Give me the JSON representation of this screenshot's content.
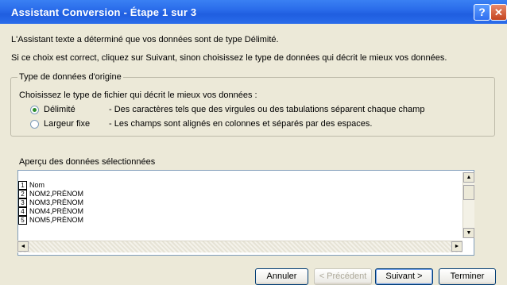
{
  "window": {
    "title": "Assistant Conversion - Étape 1 sur 3",
    "help_label": "?",
    "close_label": "✕"
  },
  "intro": {
    "line1": "L'Assistant texte a déterminé que vos données sont de type Délimité.",
    "line2": "Si ce choix est correct, cliquez sur Suivant, sinon choisissez le type de données qui décrit le mieux vos données."
  },
  "original_type": {
    "legend": "Type de données d'origine",
    "prompt": "Choisissez le type de fichier qui décrit le mieux vos données :",
    "options": [
      {
        "label": "Délimité",
        "description": "- Des caractères tels que des virgules ou des tabulations séparent chaque champ",
        "selected": true
      },
      {
        "label": "Largeur fixe",
        "description": "- Les champs sont alignés en colonnes et séparés par des espaces.",
        "selected": false
      }
    ]
  },
  "preview": {
    "label": "Aperçu des données sélectionnées",
    "rows": [
      {
        "num": "1",
        "text": "Nom"
      },
      {
        "num": "2",
        "text": "NOM2,PRÉNOM"
      },
      {
        "num": "3",
        "text": "NOM3,PRÉNOM"
      },
      {
        "num": "4",
        "text": "NOM4,PRÉNOM"
      },
      {
        "num": "5",
        "text": "NOM5,PRÉNOM"
      }
    ]
  },
  "scroll": {
    "up": "▲",
    "down": "▼",
    "left": "◄",
    "right": "►"
  },
  "buttons": {
    "cancel": "Annuler",
    "previous": "< Précédent",
    "next": "Suivant >",
    "finish": "Terminer"
  }
}
